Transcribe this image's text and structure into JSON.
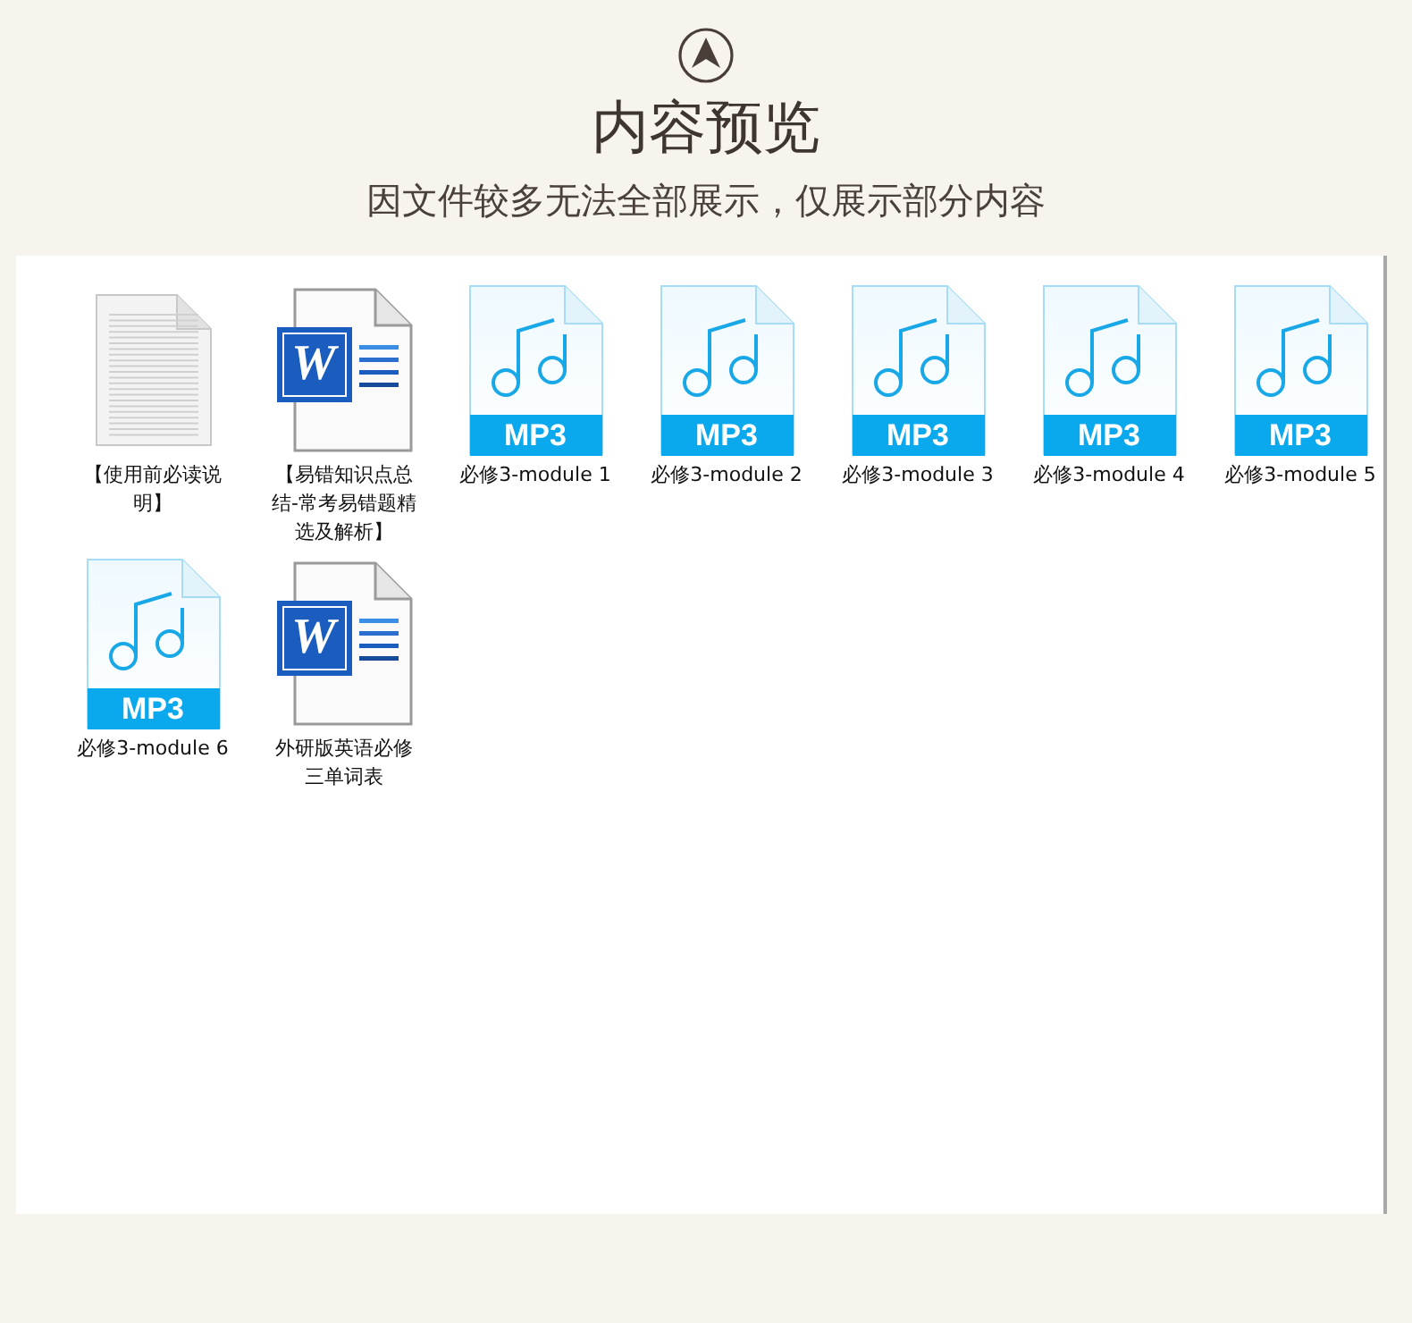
{
  "header": {
    "title": "内容预览",
    "subtitle": "因文件较多无法全部展示，仅展示部分内容"
  },
  "files": [
    {
      "kind": "text",
      "name": "【使用前必读说明】"
    },
    {
      "kind": "word",
      "badge": "W",
      "name": "【易错知识点总结-常考易错题精选及解析】"
    },
    {
      "kind": "mp3",
      "badge": "MP3",
      "name": "必修3-module 1"
    },
    {
      "kind": "mp3",
      "badge": "MP3",
      "name": "必修3-module 2"
    },
    {
      "kind": "mp3",
      "badge": "MP3",
      "name": "必修3-module 3"
    },
    {
      "kind": "mp3",
      "badge": "MP3",
      "name": "必修3-module 4"
    },
    {
      "kind": "mp3",
      "badge": "MP3",
      "name": "必修3-module 5"
    },
    {
      "kind": "mp3",
      "badge": "MP3",
      "name": "必修3-module 6"
    },
    {
      "kind": "word",
      "badge": "W",
      "name": "外研版英语必修三单词表"
    }
  ]
}
